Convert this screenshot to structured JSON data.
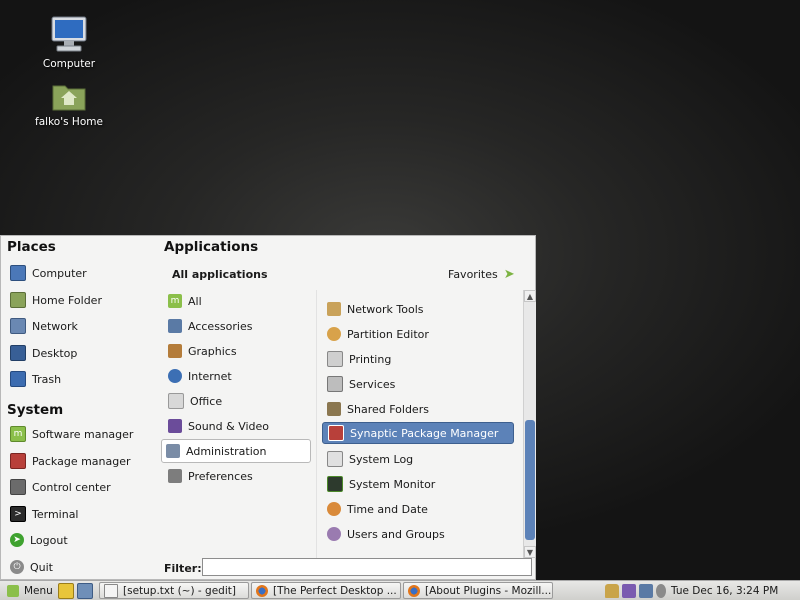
{
  "desktop": {
    "icons": [
      {
        "label": "Computer",
        "icon": "computer-icon"
      },
      {
        "label": "falko's Home",
        "icon": "home-folder-icon"
      }
    ]
  },
  "menu": {
    "places_title": "Places",
    "places": [
      {
        "label": "Computer",
        "icon": "computer-icon"
      },
      {
        "label": "Home Folder",
        "icon": "home-folder-icon"
      },
      {
        "label": "Network",
        "icon": "network-icon"
      },
      {
        "label": "Desktop",
        "icon": "desktop-icon"
      },
      {
        "label": "Trash",
        "icon": "trash-icon"
      }
    ],
    "system_title": "System",
    "system": [
      {
        "label": "Software manager",
        "icon": "software-manager-icon"
      },
      {
        "label": "Package manager",
        "icon": "package-manager-icon"
      },
      {
        "label": "Control center",
        "icon": "control-center-icon"
      },
      {
        "label": "Terminal",
        "icon": "terminal-icon"
      },
      {
        "label": "Logout",
        "icon": "logout-icon"
      },
      {
        "label": "Quit",
        "icon": "quit-icon"
      }
    ],
    "applications_title": "Applications",
    "all_applications_label": "All applications",
    "favorites_label": "Favorites",
    "categories": [
      {
        "label": "All",
        "icon": "mint-icon"
      },
      {
        "label": "Accessories",
        "icon": "accessories-icon"
      },
      {
        "label": "Graphics",
        "icon": "graphics-icon"
      },
      {
        "label": "Internet",
        "icon": "internet-icon"
      },
      {
        "label": "Office",
        "icon": "office-icon"
      },
      {
        "label": "Sound & Video",
        "icon": "sound-video-icon"
      },
      {
        "label": "Administration",
        "icon": "administration-icon"
      },
      {
        "label": "Preferences",
        "icon": "preferences-icon"
      }
    ],
    "selected_category": "Administration",
    "apps": [
      {
        "label": "Network Tools",
        "icon": "network-tools-icon"
      },
      {
        "label": "Partition Editor",
        "icon": "partition-editor-icon"
      },
      {
        "label": "Printing",
        "icon": "printer-icon"
      },
      {
        "label": "Services",
        "icon": "services-icon"
      },
      {
        "label": "Shared Folders",
        "icon": "shared-folders-icon"
      },
      {
        "label": "Synaptic Package Manager",
        "icon": "synaptic-icon"
      },
      {
        "label": "System Log",
        "icon": "system-log-icon"
      },
      {
        "label": "System Monitor",
        "icon": "system-monitor-icon"
      },
      {
        "label": "Time and Date",
        "icon": "time-date-icon"
      },
      {
        "label": "Users and Groups",
        "icon": "users-groups-icon"
      }
    ],
    "selected_app": "Synaptic Package Manager",
    "filter_label": "Filter:",
    "filter_value": ""
  },
  "taskbar": {
    "menu_label": "Menu",
    "windows": [
      {
        "label": "[setup.txt (~) - gedit]",
        "icon": "gedit-icon"
      },
      {
        "label": "[The Perfect Desktop ...",
        "icon": "firefox-icon"
      },
      {
        "label": "[About Plugins - Mozill...",
        "icon": "firefox-icon"
      }
    ],
    "clock": "Tue Dec 16,  3:24 PM"
  },
  "colors": {
    "accent": "#5c82b8",
    "mint_green": "#8bbf4a",
    "panel_bg": "#f4f4f3"
  }
}
